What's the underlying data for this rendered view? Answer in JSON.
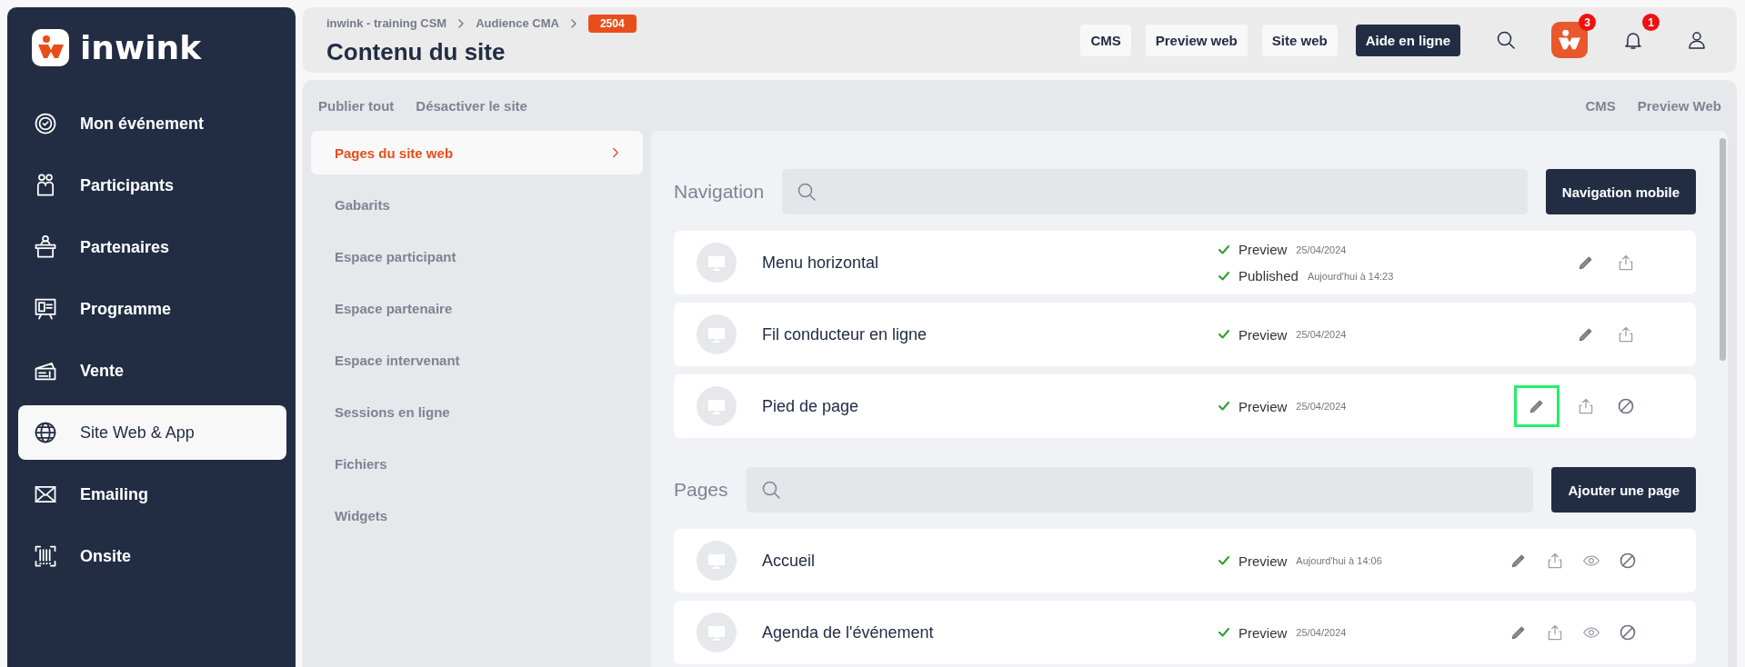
{
  "sidebar": {
    "logo": "inwink",
    "items": [
      {
        "label": "Mon événement",
        "selected": false
      },
      {
        "label": "Participants",
        "selected": false
      },
      {
        "label": "Partenaires",
        "selected": false
      },
      {
        "label": "Programme",
        "selected": false
      },
      {
        "label": "Vente",
        "selected": false
      },
      {
        "label": "Site Web & App",
        "selected": true
      },
      {
        "label": "Emailing",
        "selected": false
      },
      {
        "label": "Onsite",
        "selected": false
      }
    ]
  },
  "header": {
    "breadcrumb": [
      "inwink - training CSM",
      "Audience CMA"
    ],
    "breadcrumb_badge": "2504",
    "title": "Contenu du site",
    "buttons": [
      {
        "label": "CMS",
        "kind": "light"
      },
      {
        "label": "Preview web",
        "kind": "light"
      },
      {
        "label": "Site web",
        "kind": "light"
      },
      {
        "label": "Aide en ligne",
        "kind": "dark"
      }
    ],
    "app_badge": "3",
    "notifications_badge": "1"
  },
  "toolbar": {
    "left": [
      "Publier tout",
      "Désactiver le site"
    ],
    "right": [
      "CMS",
      "Preview Web"
    ]
  },
  "nav": {
    "items": [
      {
        "label": "Pages du site web",
        "selected": true
      },
      {
        "label": "Gabarits",
        "selected": false
      },
      {
        "label": "Espace participant",
        "selected": false
      },
      {
        "label": "Espace partenaire",
        "selected": false
      },
      {
        "label": "Espace intervenant",
        "selected": false
      },
      {
        "label": "Sessions en ligne",
        "selected": false
      },
      {
        "label": "Fichiers",
        "selected": false
      },
      {
        "label": "Widgets",
        "selected": false
      }
    ]
  },
  "sections": [
    {
      "title": "Navigation",
      "button": "Navigation mobile",
      "rows": [
        {
          "name": "Menu horizontal",
          "statuses": [
            {
              "label": "Preview",
              "date": "25/04/2024",
              "done": true
            },
            {
              "label": "Published",
              "date": "Aujourd'hui à 14:23",
              "done": true
            }
          ],
          "actions": [
            {
              "kind": "edit",
              "highlighted": false
            },
            {
              "kind": "publish",
              "highlighted": false
            }
          ]
        },
        {
          "name": "Fil conducteur en ligne",
          "statuses": [
            {
              "label": "Preview",
              "date": "25/04/2024",
              "done": true
            }
          ],
          "actions": [
            {
              "kind": "edit",
              "highlighted": false
            },
            {
              "kind": "publish",
              "highlighted": false
            }
          ]
        },
        {
          "name": "Pied de page",
          "statuses": [
            {
              "label": "Preview",
              "date": "25/04/2024",
              "done": true
            }
          ],
          "actions": [
            {
              "kind": "edit",
              "highlighted": true
            },
            {
              "kind": "publish",
              "highlighted": false
            },
            {
              "kind": "disable",
              "highlighted": false
            }
          ]
        }
      ]
    },
    {
      "title": "Pages",
      "button": "Ajouter une page",
      "rows": [
        {
          "name": "Accueil",
          "statuses": [
            {
              "label": "Preview",
              "date": "Aujourd'hui à 14:06",
              "done": true
            }
          ],
          "actions": [
            {
              "kind": "edit",
              "highlighted": false
            },
            {
              "kind": "publish",
              "highlighted": false
            },
            {
              "kind": "view",
              "highlighted": false
            },
            {
              "kind": "disable",
              "highlighted": false
            }
          ]
        },
        {
          "name": "Agenda de l'événement",
          "statuses": [
            {
              "label": "Preview",
              "date": "25/04/2024",
              "done": true
            }
          ],
          "actions": [
            {
              "kind": "edit",
              "highlighted": false
            },
            {
              "kind": "publish",
              "highlighted": false
            },
            {
              "kind": "view",
              "highlighted": false
            },
            {
              "kind": "disable",
              "highlighted": false
            }
          ]
        }
      ]
    }
  ]
}
